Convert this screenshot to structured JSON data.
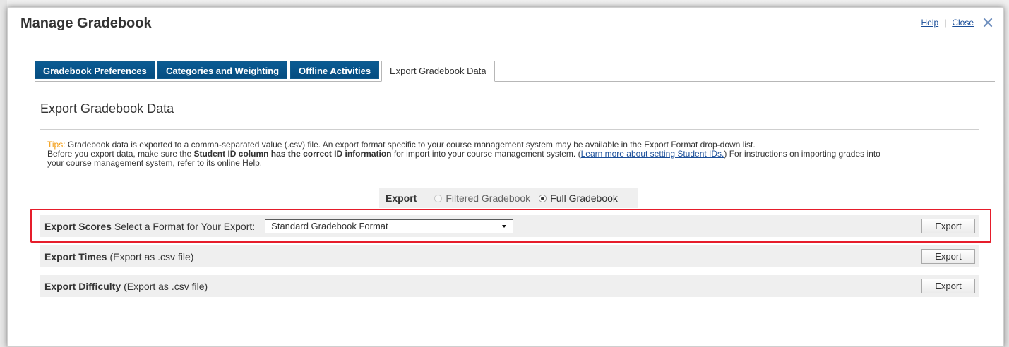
{
  "dialog": {
    "title": "Manage Gradebook",
    "help_label": "Help",
    "separator": "|",
    "close_label": "Close",
    "close_icon": "close-icon"
  },
  "tabs": [
    {
      "label": "Gradebook Preferences",
      "active": false
    },
    {
      "label": "Categories and Weighting",
      "active": false
    },
    {
      "label": "Offline Activities",
      "active": false
    },
    {
      "label": "Export Gradebook Data",
      "active": true
    }
  ],
  "page": {
    "heading": "Export Gradebook Data"
  },
  "tips": {
    "label": "Tips:",
    "line1": "Gradebook data is exported to a comma-separated value (.csv) file. An export format specific to your course management system may be available in the Export Format drop-down list.",
    "line2_prefix": "Before you export data, make sure the ",
    "line2_bold": "Student ID column has the correct ID information",
    "line2_middle": " for import into your course management system. (",
    "line2_link": "Learn more about setting Student IDs.",
    "line2_suffix": ") For instructions on importing grades into",
    "line3": "your course management system, refer to its online Help."
  },
  "export_scope": {
    "label": "Export",
    "options": [
      {
        "label": "Filtered Gradebook",
        "selected": false,
        "disabled": true
      },
      {
        "label": "Full Gradebook",
        "selected": true,
        "disabled": false
      }
    ]
  },
  "rows": [
    {
      "title": "Export Scores",
      "description": "Select a Format for Your Export:",
      "select_value": "Standard Gradebook Format",
      "button_label": "Export"
    },
    {
      "title": "Export Times",
      "description": "(Export as .csv file)",
      "button_label": "Export"
    },
    {
      "title": "Export Difficulty",
      "description": "(Export as .csv file)",
      "button_label": "Export"
    }
  ],
  "colors": {
    "tab_blue": "#0a5b93",
    "highlight_red": "#e61d2b",
    "tips_orange": "#f39c12",
    "link_blue": "#1a4e99"
  }
}
